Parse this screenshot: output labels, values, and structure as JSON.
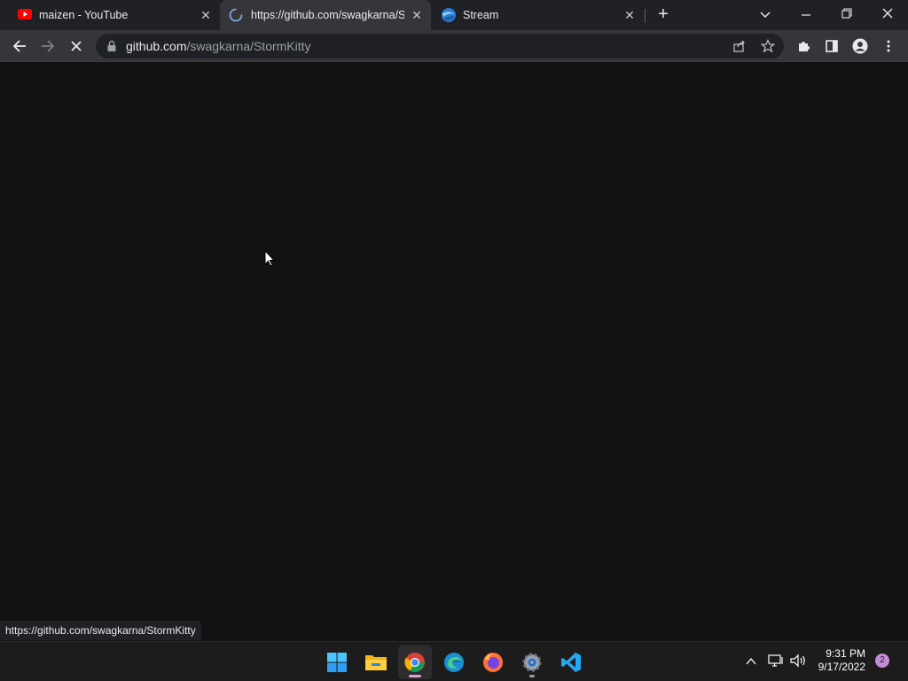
{
  "browser": {
    "tabs": [
      {
        "title": "maizen - YouTube",
        "icon": "youtube-icon",
        "active": false
      },
      {
        "title": "https://github.com/swagkarna/St",
        "icon": "loading-spinner-icon",
        "active": true
      },
      {
        "title": "Stream",
        "icon": "globe-stream-icon",
        "active": false
      }
    ],
    "close_glyph": "✕",
    "new_tab_glyph": "+",
    "address": {
      "host": "github.com",
      "path": "/swagkarna/StormKitty"
    },
    "status_url": "https://github.com/swagkarna/StormKitty"
  },
  "taskbar": {
    "apps": [
      "start-icon",
      "file-explorer-icon",
      "chrome-icon",
      "edge-icon",
      "firefox-icon",
      "settings-icon",
      "vscode-icon"
    ],
    "clock_time": "9:31 PM",
    "clock_date": "9/17/2022",
    "notification_count": "2"
  },
  "colors": {
    "page_background": "#121212",
    "tabstrip": "#202124",
    "toolbar": "#35363a"
  }
}
